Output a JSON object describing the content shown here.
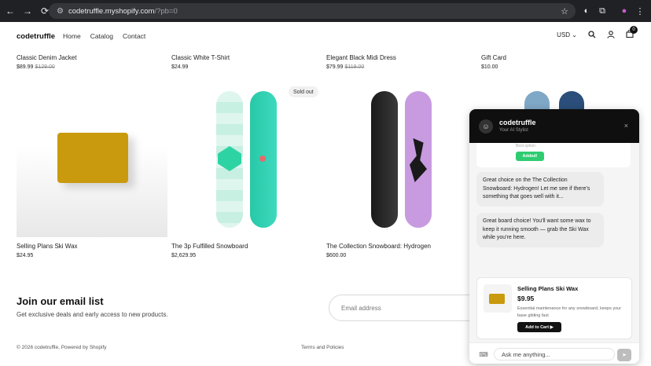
{
  "browser": {
    "back": "←",
    "forward": "→",
    "reload": "⟳",
    "url_host": "codetruffle.myshopify.com",
    "url_path": "/?pb=0",
    "site_settings_icon": "tune-icon",
    "star_icon": "star-icon",
    "extensions_icon": "puzzle-icon"
  },
  "header": {
    "logo": "codetruffle",
    "nav": [
      "Home",
      "Catalog",
      "Contact"
    ],
    "currency": "USD",
    "cart_count": "0"
  },
  "products": [
    {
      "name": "Classic Denim Jacket",
      "price": "$89.99",
      "compare_at": "$129.00"
    },
    {
      "name": "Classic White T-Shirt",
      "price": "$24.99",
      "compare_at": ""
    },
    {
      "name": "Elegant Black Midi Dress",
      "price": "$79.99",
      "compare_at": "$119.00"
    },
    {
      "name": "Gift Card",
      "price": "$10.00",
      "compare_at": ""
    },
    {
      "name": "Selling Plans Ski Wax",
      "price": "$24.95",
      "compare_at": ""
    },
    {
      "name": "The 3p Fulfilled Snowboard",
      "price": "$2,629.95",
      "compare_at": ""
    },
    {
      "name": "The Collection Snowboard: Hydrogen",
      "price": "$600.00",
      "compare_at": ""
    }
  ],
  "sold_out_label": "Sold out",
  "newsletter": {
    "title": "Join our email list",
    "subtitle": "Get exclusive deals and early access to new products.",
    "placeholder": "Email address"
  },
  "footer": {
    "copyright": "© 2026 codetruffle, Powered by Shopify",
    "terms": "Terms and Policies"
  },
  "chat": {
    "name": "codetruffle",
    "subtitle": "Your AI Stylist",
    "close": "×",
    "previous_card_text": "Best option",
    "added_label": "Added!",
    "messages": [
      "Great choice on the The Collection Snowboard: Hydrogen! Let me see if there's something that goes well with it...",
      "Great board choice! You'll want some wax to keep it running smooth — grab the Ski Wax while you're here."
    ],
    "product": {
      "name": "Selling Plans Ski Wax",
      "price": "$9.95",
      "description": "Essential maintenance for any snowboard, keeps your base gliding fast",
      "button": "Add to Cart ▶"
    },
    "input_placeholder": "Ask me anything...",
    "send": "➤"
  },
  "colors": {
    "chat_header": "#0f0f0f",
    "added_green": "#2ecc71",
    "wax": "#c99a0e"
  }
}
